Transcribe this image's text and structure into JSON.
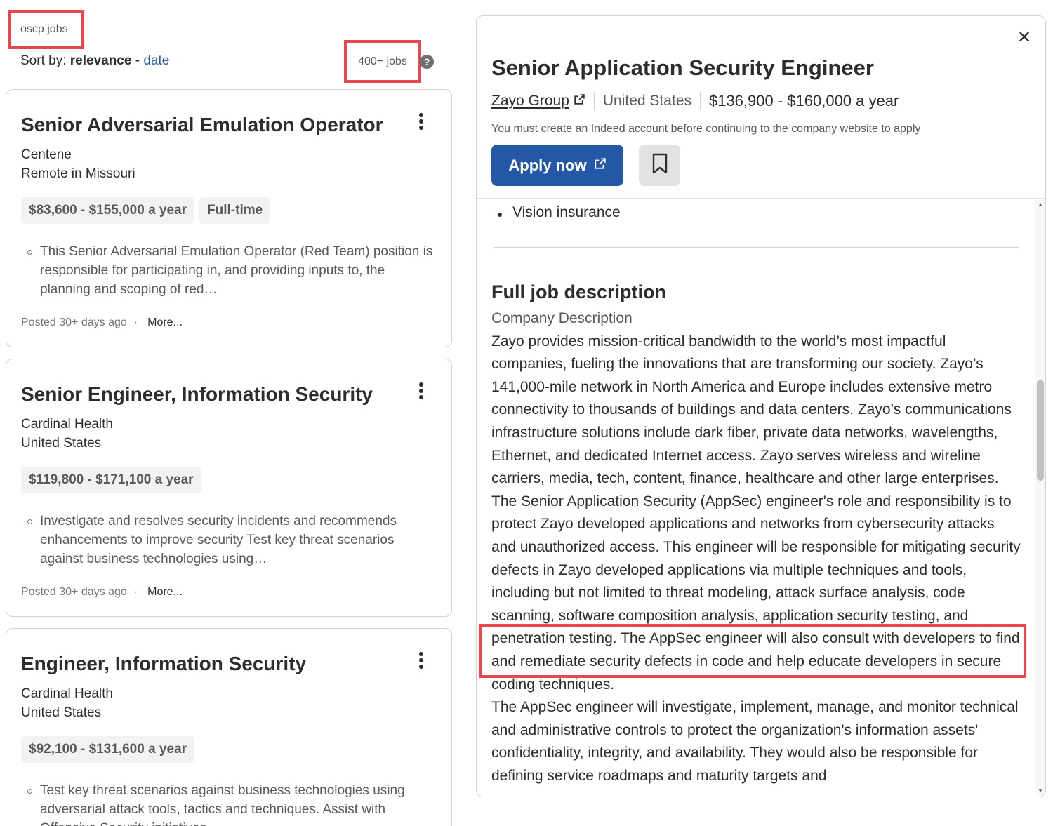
{
  "search": {
    "query": "oscp jobs"
  },
  "sort": {
    "label": "Sort by:",
    "active": "relevance",
    "separator": "-",
    "alternate": "date"
  },
  "results": {
    "count_label": "400+ jobs",
    "help_glyph": "?"
  },
  "jobs": [
    {
      "title": "Senior Adversarial Emulation Operator",
      "company": "Centene",
      "location": "Remote in Missouri",
      "tags": [
        "$83,600 - $155,000 a year",
        "Full-time"
      ],
      "snippet": "This Senior Adversarial Emulation Operator (Red Team) position is responsible for participating in, and providing inputs to, the planning and scoping of red…",
      "posted": "Posted 30+ days ago",
      "more": "More..."
    },
    {
      "title": "Senior Engineer, Information Security",
      "company": "Cardinal Health",
      "location": "United States",
      "tags": [
        "$119,800 - $171,100 a year"
      ],
      "snippet": "Investigate and resolves security incidents and recommends enhancements to improve security Test key threat scenarios against business technologies using…",
      "posted": "Posted 30+ days ago",
      "more": "More..."
    },
    {
      "title": "Engineer, Information Security",
      "company": "Cardinal Health",
      "location": "United States",
      "tags": [
        "$92,100 - $131,600 a year"
      ],
      "snippet": "Test key threat scenarios against business technologies using adversarial attack tools, tactics and techniques. Assist with Offensive Security initiatives…",
      "posted": "",
      "more": ""
    }
  ],
  "detail": {
    "title": "Senior Application Security Engineer",
    "company": "Zayo Group",
    "location": "United States",
    "salary": "$136,900 - $160,000 a year",
    "notice": "You must create an Indeed account before continuing to the company website to apply",
    "apply_label": "Apply now",
    "benefit_item": "Vision insurance",
    "section_title": "Full job description",
    "subheading": "Company Description",
    "paragraph_1": "Zayo provides mission-critical bandwidth to the world’s most impactful companies, fueling the innovations that are transforming our society. Zayo’s 141,000-mile network in North America and Europe includes extensive metro connectivity to thousands of buildings and data centers. Zayo’s communications infrastructure solutions include dark fiber, private data networks, wavelengths, Ethernet, and dedicated Internet access. Zayo serves wireless and wireline carriers, media, tech, content, finance, healthcare and other large enterprises.",
    "paragraph_2": "The Senior Application Security (AppSec) engineer's role and responsibility is to protect Zayo developed applications and networks from cybersecurity attacks and unauthorized access. This engineer will be responsible for mitigating security defects in Zayo developed applications via multiple techniques and tools, including but not limited to threat modeling, attack surface analysis, code scanning, software composition analysis, application security testing, and penetration testing. The AppSec engineer will also consult with developers to find and remediate security defects in code and help educate developers in secure coding techniques.",
    "paragraph_3": "The AppSec engineer will investigate, implement, manage, and monitor technical and administrative controls to protect the organization's information assets' confidentiality, integrity, and availability. They would also be responsible for defining service roadmaps and maturity targets and"
  },
  "colors": {
    "accent": "#2557a7",
    "annotation": "#e8474c",
    "tag_bg": "#f3f2f1"
  },
  "icons": [
    "help-icon",
    "kebab-menu-icon",
    "external-link-icon",
    "close-icon",
    "bookmark-icon"
  ]
}
